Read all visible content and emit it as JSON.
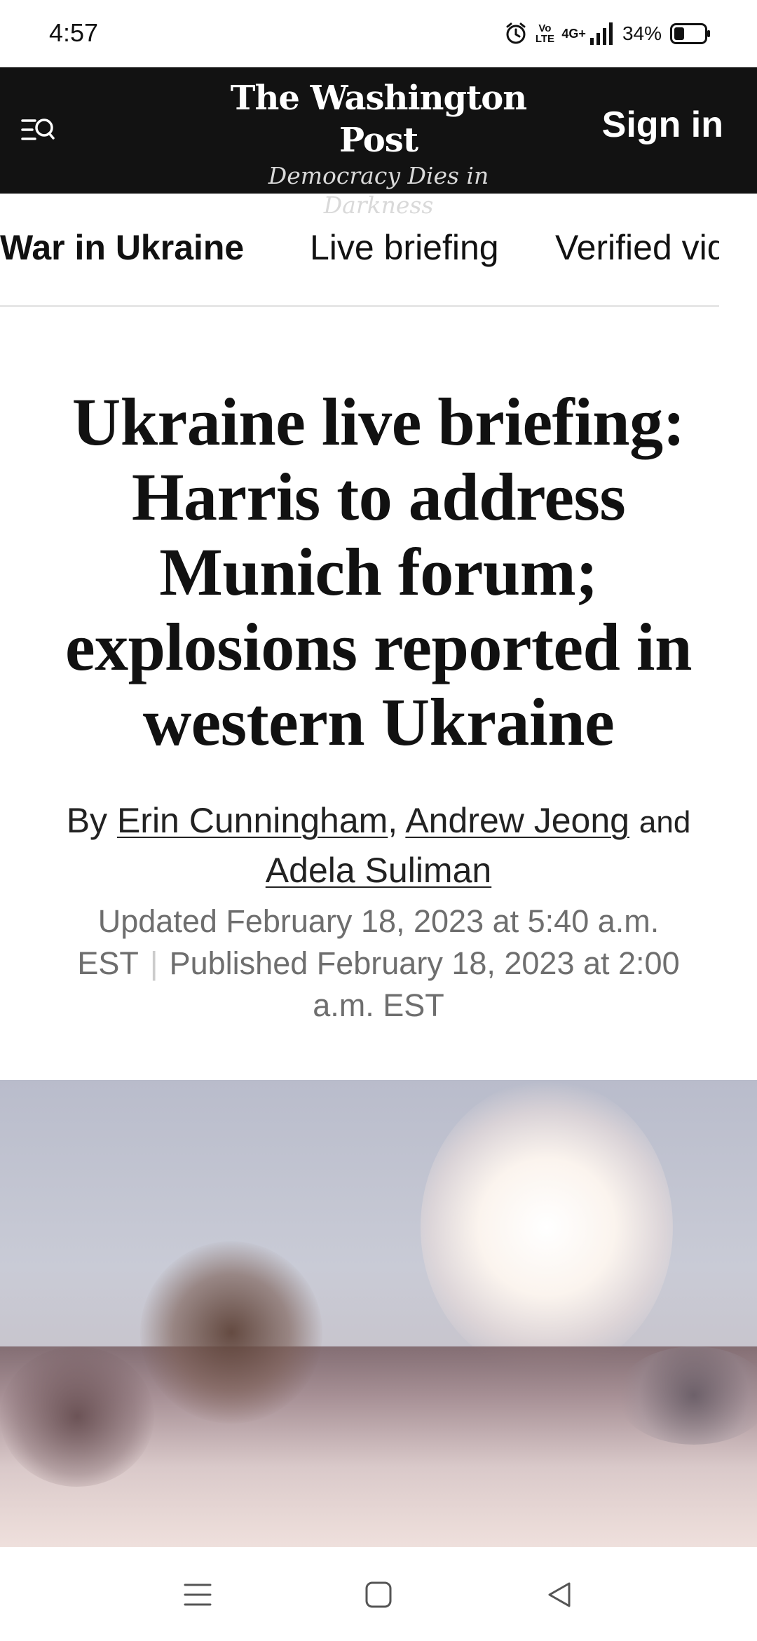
{
  "status_bar": {
    "time": "4:57",
    "volte_top": "Vo",
    "volte_bottom": "LTE",
    "network": "4G+",
    "battery_percent": "34%",
    "battery_level": 0.34
  },
  "header": {
    "masthead": "The Washington Post",
    "tagline": "Democracy Dies in Darkness",
    "sign_in": "Sign in"
  },
  "section_nav": {
    "items": [
      {
        "label": "War in Ukraine",
        "active": true
      },
      {
        "label": "Live briefing",
        "active": false
      },
      {
        "label": "Verified video",
        "active": false
      }
    ]
  },
  "article": {
    "headline": "Ukraine live briefing: Harris to address Munich forum; explosions reported in western Ukraine",
    "byline": {
      "by": "By",
      "authors": [
        "Erin Cunningham",
        "Andrew Jeong",
        "Adela Suliman"
      ],
      "comma": ",",
      "and": "and"
    },
    "updated": "Updated February 18, 2023 at 5:40 a.m. EST",
    "separator": "|",
    "published": "Published February 18, 2023 at 2:00 a.m. EST"
  },
  "colors": {
    "header_bg": "#121212",
    "text": "#111111",
    "meta_text": "#6e6e6e"
  }
}
